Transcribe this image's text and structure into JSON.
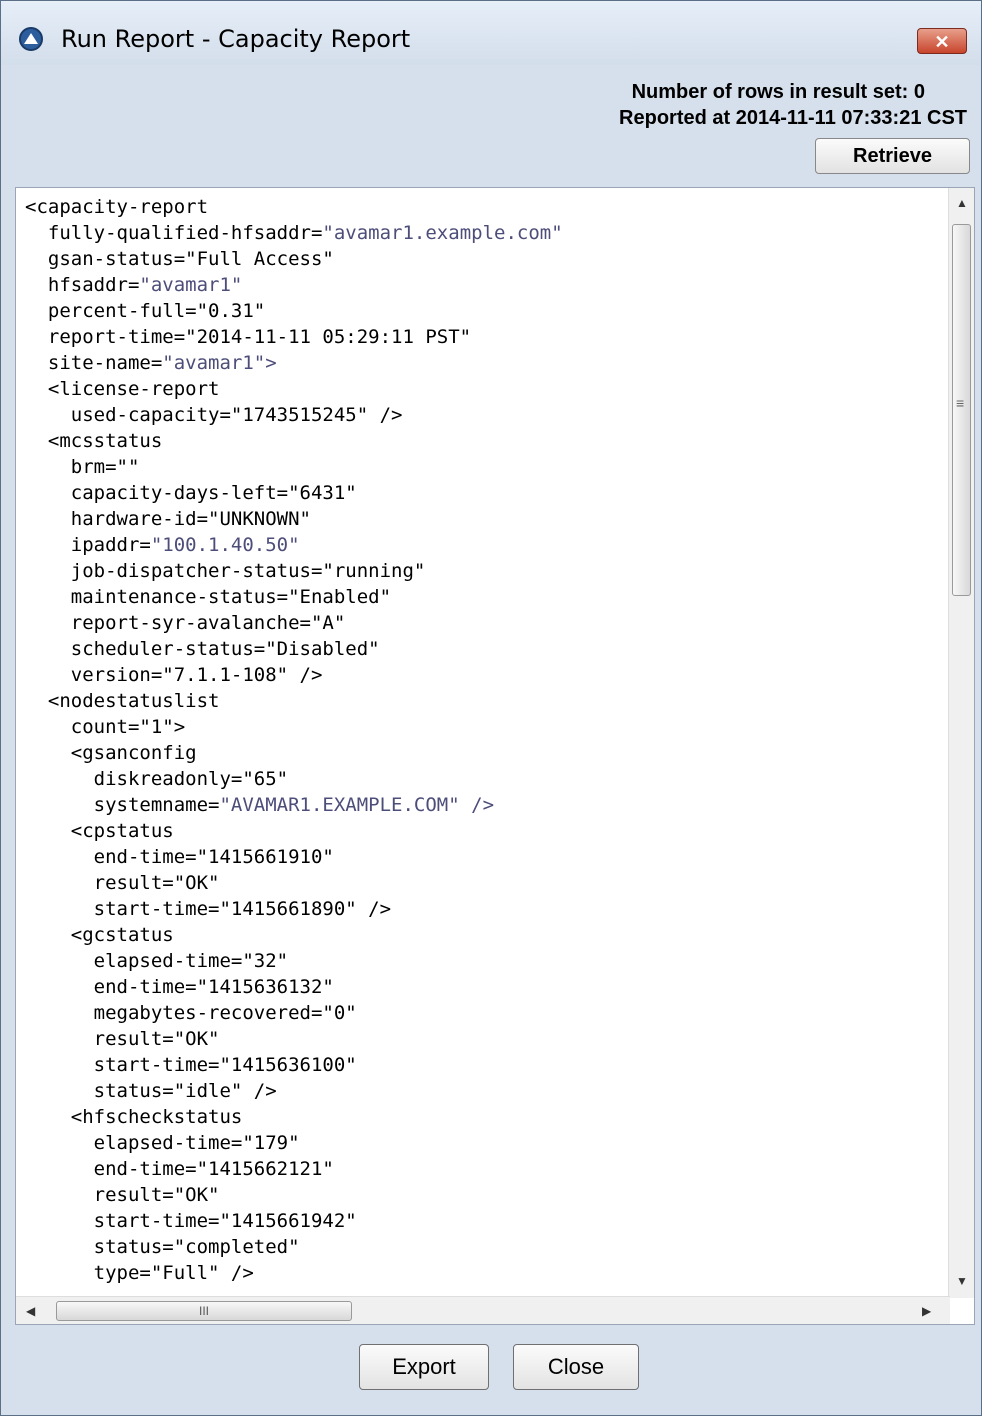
{
  "window": {
    "title": "Run Report - Capacity Report",
    "close_glyph": "✕"
  },
  "header": {
    "rows_label": "Number of rows in result set: 0",
    "reported_at": "Reported at 2014-11-11 07:33:21 CST",
    "retrieve_label": "Retrieve"
  },
  "report": {
    "lines": [
      [
        "",
        "<capacity-report"
      ],
      [
        "",
        "  fully-qualified-hfsaddr=",
        "\"avamar1.example.com\""
      ],
      [
        "",
        "  gsan-status=\"Full Access\""
      ],
      [
        "",
        "  hfsaddr=",
        "\"avamar1\""
      ],
      [
        "",
        "  percent-full=\"0.31\""
      ],
      [
        "",
        "  report-time=\"2014-11-11 05:29:11 PST\""
      ],
      [
        "",
        "  site-name=",
        "\"avamar1\">"
      ],
      [
        "",
        "  <license-report"
      ],
      [
        "",
        "    used-capacity=\"1743515245\" />"
      ],
      [
        "",
        "  <mcsstatus"
      ],
      [
        "",
        "    brm=\"\""
      ],
      [
        "",
        "    capacity-days-left=\"6431\""
      ],
      [
        "",
        "    hardware-id=\"UNKNOWN\""
      ],
      [
        "",
        "    ipaddr=",
        "\"100.1.40.50\""
      ],
      [
        "",
        "    job-dispatcher-status=\"running\""
      ],
      [
        "",
        "    maintenance-status=\"Enabled\""
      ],
      [
        "",
        "    report-syr-avalanche=\"A\""
      ],
      [
        "",
        "    scheduler-status=\"Disabled\""
      ],
      [
        "",
        "    version=\"7.1.1-108\" />"
      ],
      [
        "",
        "  <nodestatuslist"
      ],
      [
        "",
        "    count=\"1\">"
      ],
      [
        "",
        "    <gsanconfig"
      ],
      [
        "",
        "      diskreadonly=\"65\""
      ],
      [
        "",
        "      systemname=",
        "\"AVAMAR1.EXAMPLE.COM\" />"
      ],
      [
        "",
        "    <cpstatus"
      ],
      [
        "",
        "      end-time=\"1415661910\""
      ],
      [
        "",
        "      result=\"OK\""
      ],
      [
        "",
        "      start-time=\"1415661890\" />"
      ],
      [
        "",
        "    <gcstatus"
      ],
      [
        "",
        "      elapsed-time=\"32\""
      ],
      [
        "",
        "      end-time=\"1415636132\""
      ],
      [
        "",
        "      megabytes-recovered=\"0\""
      ],
      [
        "",
        "      result=\"OK\""
      ],
      [
        "",
        "      start-time=\"1415636100\""
      ],
      [
        "",
        "      status=\"idle\" />"
      ],
      [
        "",
        "    <hfscheckstatus"
      ],
      [
        "",
        "      elapsed-time=\"179\""
      ],
      [
        "",
        "      end-time=\"1415662121\""
      ],
      [
        "",
        "      result=\"OK\""
      ],
      [
        "",
        "      start-time=\"1415661942\""
      ],
      [
        "",
        "      status=\"completed\""
      ],
      [
        "",
        "      type=\"Full\" />"
      ]
    ]
  },
  "scrollbars": {
    "up_arrow": "▲",
    "down_arrow": "▼",
    "left_arrow": "◀",
    "right_arrow": "▶",
    "grip_v": "≡",
    "grip_h": "III"
  },
  "footer": {
    "export_label": "Export",
    "close_label": "Close"
  },
  "colors": {
    "chrome": "#d6e0ec",
    "string_value": "#4d4d7a",
    "close_button": "#c8442c"
  }
}
